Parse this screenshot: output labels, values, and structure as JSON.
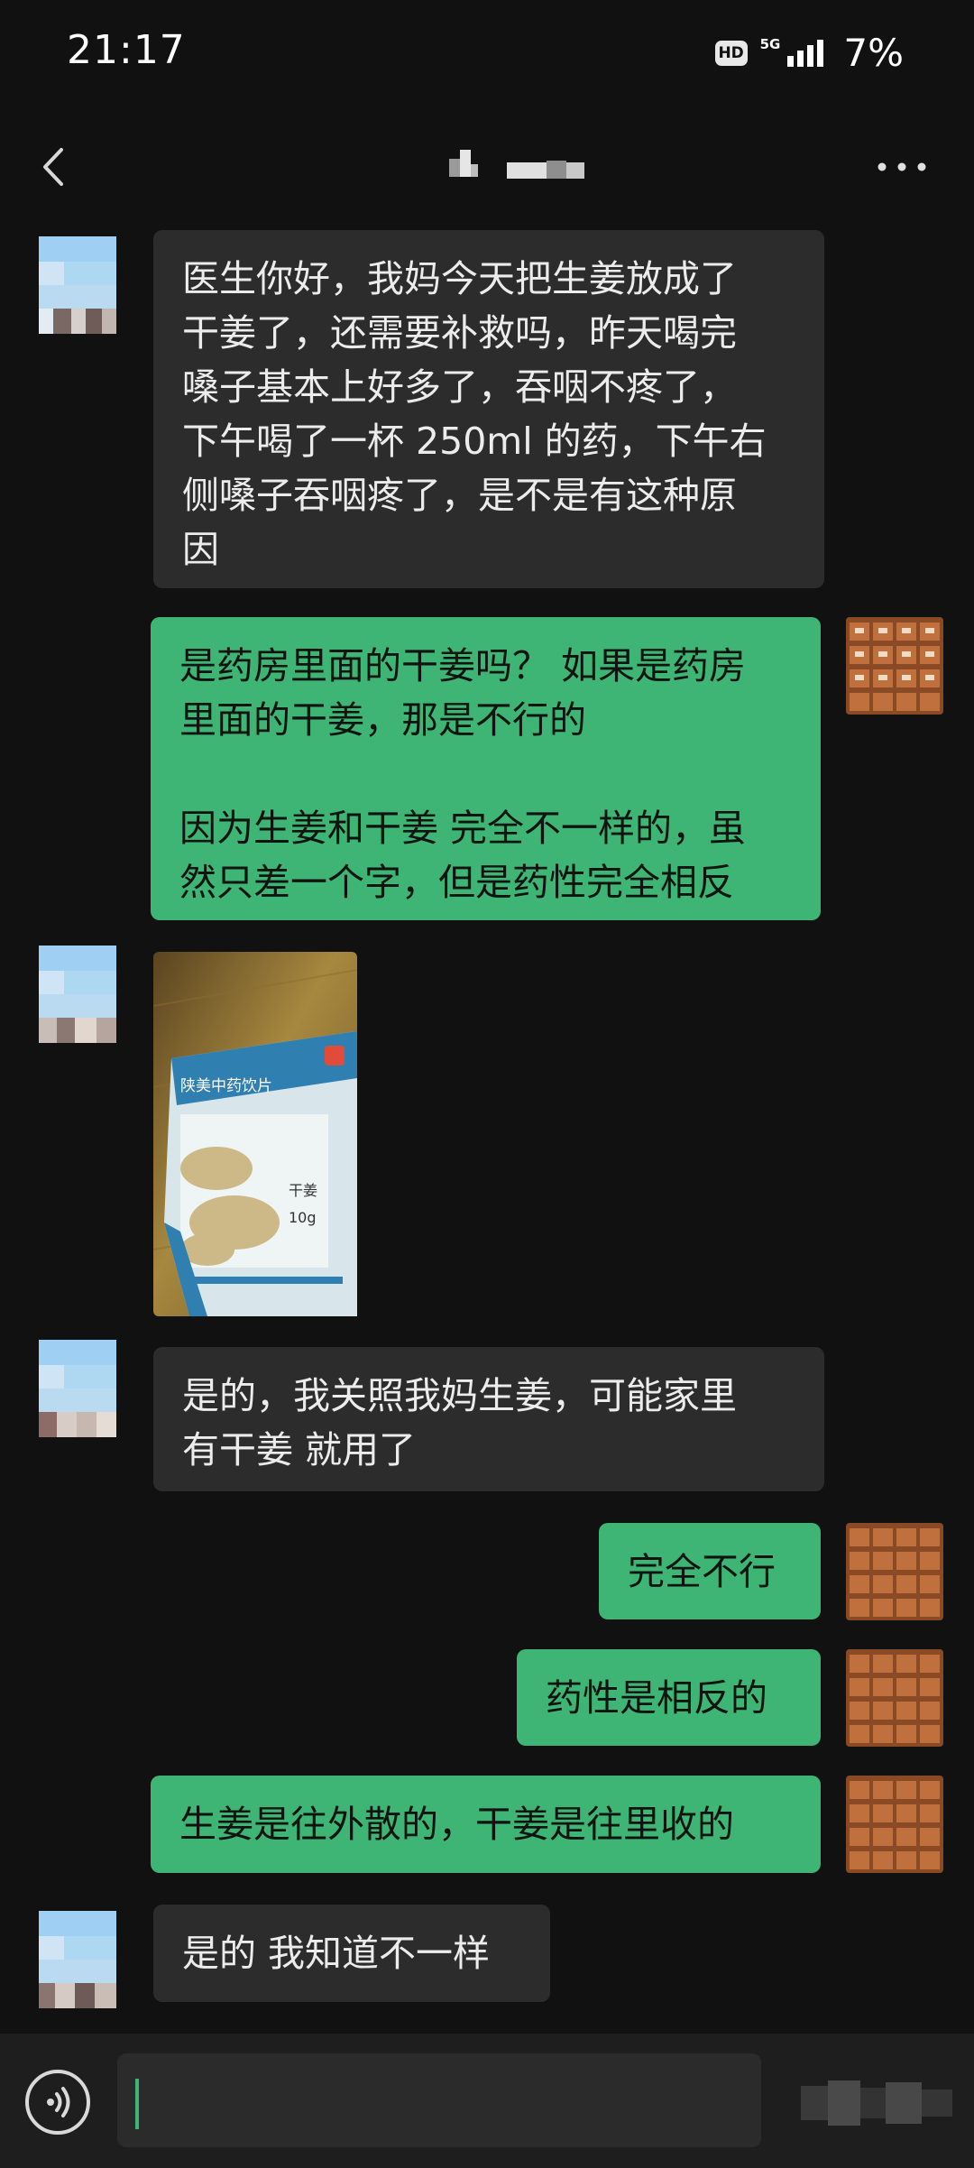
{
  "status": {
    "time": "21:17",
    "hd": "HD",
    "network": "5G",
    "battery": "7%"
  },
  "chat": {
    "icons": {
      "back": "back-chevron-icon",
      "more": "more-dots-icon",
      "voice": "voice-icon"
    },
    "messages": [
      {
        "side": "in",
        "type": "text",
        "text": "医生你好，我妈今天把生姜放成了\n干姜了，还需要补救吗，昨天喝完\n嗓子基本上好多了，吞咽不疼了，\n下午喝了一杯 250ml 的药，下午右\n侧嗓子吞咽疼了，是不是有这种原\n因"
      },
      {
        "side": "out",
        "type": "text",
        "text": "是药房里面的干姜吗？ 如果是药房\n里面的干姜，那是不行的\n\n因为生姜和干姜 完全不一样的，虽\n然只差一个字，但是药性完全相反"
      },
      {
        "side": "in",
        "type": "image",
        "package_title": "陕美中药饮片",
        "package_name": "干姜",
        "package_weight": "10g"
      },
      {
        "side": "in",
        "type": "text",
        "text": "是的，我关照我妈生姜，可能家里\n有干姜 就用了"
      },
      {
        "side": "out",
        "type": "text",
        "text": "完全不行"
      },
      {
        "side": "out",
        "type": "text",
        "text": "药性是相反的"
      },
      {
        "side": "out",
        "type": "text",
        "text": "生姜是往外散的，干姜是往里收的"
      },
      {
        "side": "in",
        "type": "text",
        "text": "是的 我知道不一样"
      }
    ]
  },
  "colors": {
    "background": "#111111",
    "incoming_bubble": "#2c2c2c",
    "outgoing_bubble": "#3eb575"
  }
}
